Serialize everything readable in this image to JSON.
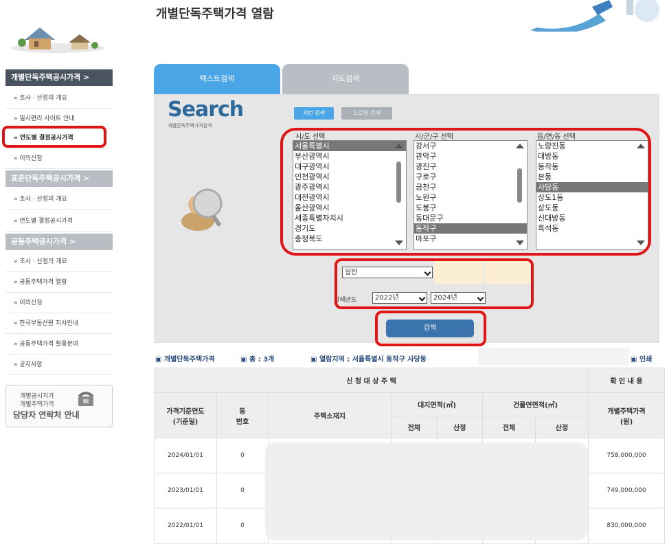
{
  "page_title": "개별단독주택가격 열람",
  "sidebar": {
    "sections": [
      {
        "label": "개별단독주택공시가격  >",
        "items": [
          "조사 · 산정의 개요",
          "일사편리 사이트 안내",
          "연도별 결정공시가격",
          "이의신청"
        ]
      },
      {
        "label": "표준단독주택공시가격  >",
        "items": [
          "조사 · 산정의 개요",
          "연도별 결정공시가격"
        ]
      },
      {
        "label": "공동주택공시가격   >",
        "items": [
          "조사 · 산정의 개요",
          "공동주택가격 열람",
          "이의신청",
          "한국부동산원 지사안내",
          "공동주택가격 활용분야",
          "공지사항"
        ]
      }
    ],
    "contact": {
      "line1": "개별공시지가",
      "line2": "개별주택가격",
      "line3": "담당자 연락처 안내"
    }
  },
  "tabs": [
    {
      "label": "텍스트검색"
    },
    {
      "label": "지도검색"
    }
  ],
  "search": {
    "word": "Search",
    "sub": "개별단독주택가격검색",
    "jibun_btn": "지번 검색",
    "road_btn": "도로명 검색",
    "col_sido": "시/도 선택",
    "col_sigungu": "시/군/구 선택",
    "col_dong": "읍/면/동 선택",
    "sido": [
      "서울특별시",
      "부산광역시",
      "대구광역시",
      "인천광역시",
      "광주광역시",
      "대전광역시",
      "울산광역시",
      "세종특별자치시",
      "경기도",
      "충청북도"
    ],
    "sido_selected": 0,
    "sigungu": [
      "강서구",
      "관악구",
      "광진구",
      "구로구",
      "금천구",
      "노원구",
      "도봉구",
      "동대문구",
      "동작구",
      "마포구"
    ],
    "sigungu_selected": 8,
    "dong": [
      "노량진동",
      "대방동",
      "동작동",
      "본동",
      "사당동",
      "상도1동",
      "상도동",
      "신대방동",
      "흑석동"
    ],
    "dong_selected": 4,
    "type_value": "일반",
    "dash": "-",
    "year_label": "검색년도",
    "year_from": "2022년",
    "year_to": "2024년",
    "search_btn": "검색"
  },
  "info": {
    "title": "개별단독주택가격",
    "total": "총 : 3개",
    "region": "열람지역 : 서울특별시 동작구 사당동",
    "print": "인쇄"
  },
  "table": {
    "group_left": "신 청 대 상 주 택",
    "group_right": "확 인 내 용",
    "col_year": "가격기준연도\n(기준일)",
    "col_dong": "동\n번호",
    "col_addr": "주택소재지",
    "col_land": "대지면적(㎡)",
    "col_bldg": "건물연면적(㎡)",
    "col_price": "개별주택가격\n(원)",
    "sub_total": "전체",
    "sub_calc": "산정",
    "rows": [
      {
        "date": "2024/01/01",
        "dong": "0",
        "price": "758,000,000"
      },
      {
        "date": "2023/01/01",
        "dong": "0",
        "price": "749,000,000"
      },
      {
        "date": "2022/01/01",
        "dong": "0",
        "price": "830,000,000"
      }
    ]
  },
  "colors": {
    "sidebar_dark": "#4a5360",
    "tab_active": "#4aa6e6",
    "highlight_red": "#e01515",
    "search_btn": "#3b73ad"
  }
}
